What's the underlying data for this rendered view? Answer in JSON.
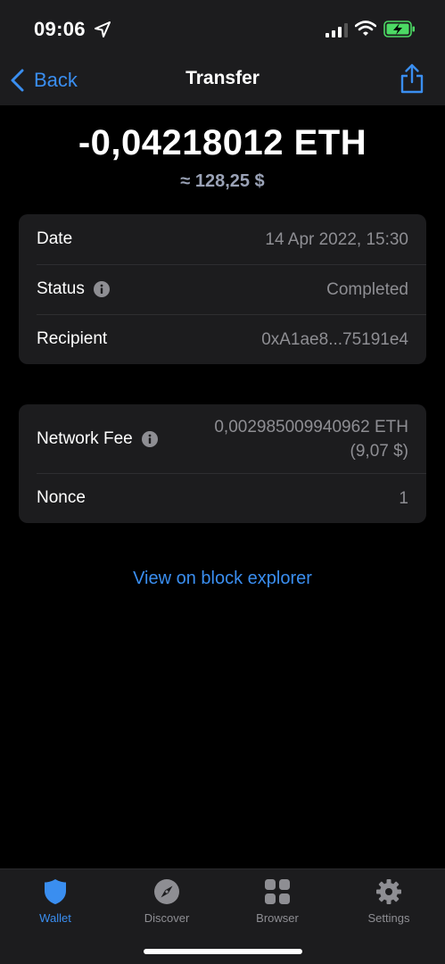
{
  "status_bar": {
    "time": "09:06"
  },
  "nav": {
    "back_label": "Back",
    "title": "Transfer"
  },
  "amount": {
    "crypto": "-0,04218012 ETH",
    "fiat": "≈ 128,25 $"
  },
  "details": {
    "date_label": "Date",
    "date_value": "14 Apr 2022, 15:30",
    "status_label": "Status",
    "status_value": "Completed",
    "recipient_label": "Recipient",
    "recipient_value": "0xA1ae8...75191e4"
  },
  "fees": {
    "fee_label": "Network Fee",
    "fee_value": "0,002985009940962 ETH",
    "fee_fiat": "(9,07 $)",
    "nonce_label": "Nonce",
    "nonce_value": "1"
  },
  "explorer_link": "View on block explorer",
  "tabs": [
    {
      "label": "Wallet",
      "icon": "shield-icon",
      "active": true
    },
    {
      "label": "Discover",
      "icon": "compass-icon",
      "active": false
    },
    {
      "label": "Browser",
      "icon": "grid-icon",
      "active": false
    },
    {
      "label": "Settings",
      "icon": "gear-icon",
      "active": false
    }
  ],
  "colors": {
    "accent": "#3a8ef0",
    "card": "#1c1c1e",
    "muted": "#8e8e93",
    "battery": "#4cd964"
  }
}
